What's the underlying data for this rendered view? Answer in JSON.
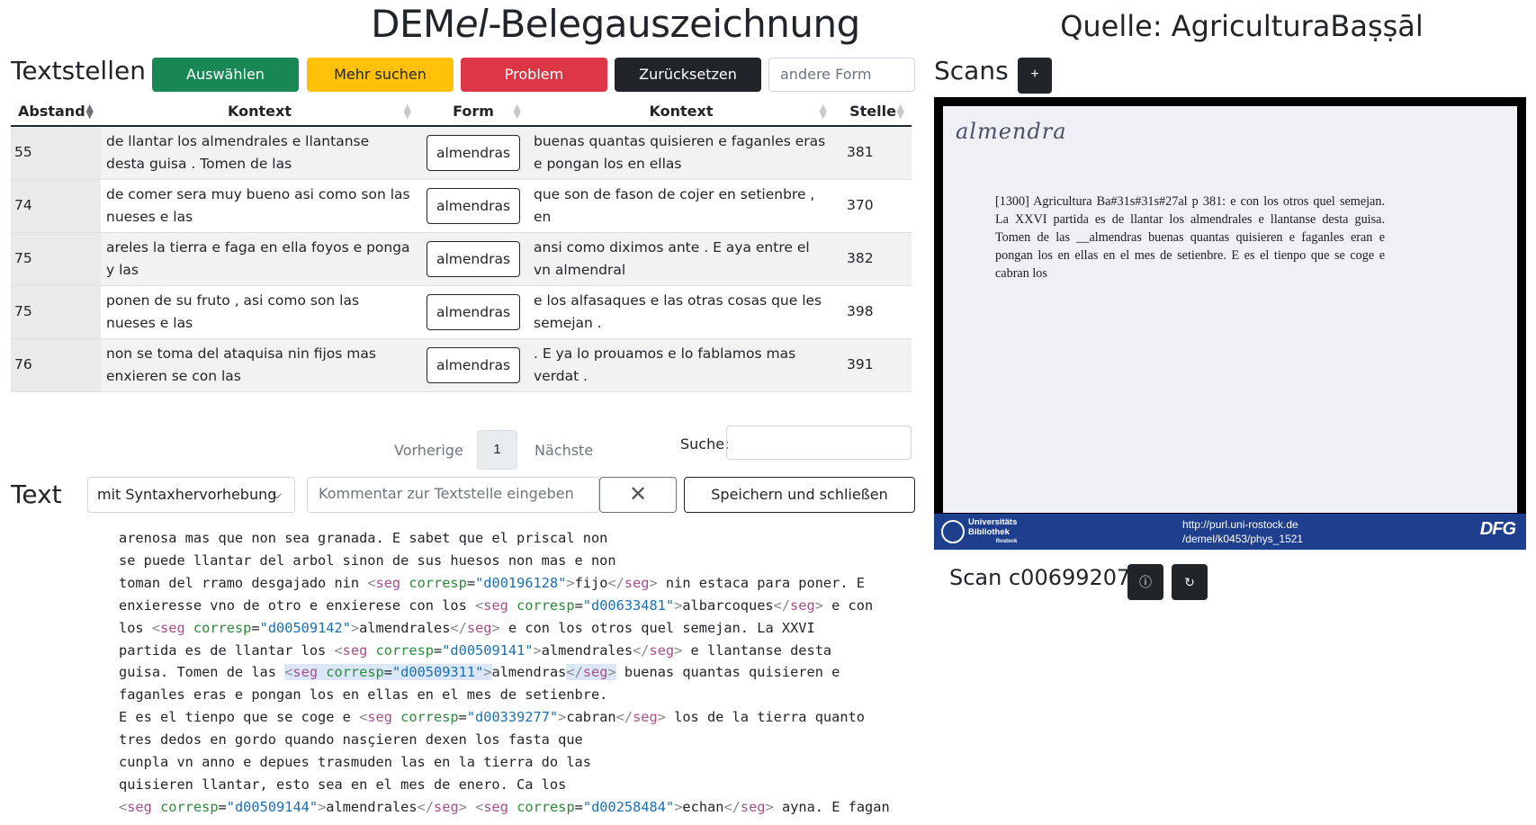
{
  "header": {
    "title_prefix": "DEM",
    "title_italic": "el",
    "title_suffix": "-Belegauszeichnung",
    "source": "Quelle: AgriculturaBaṣṣāl"
  },
  "textstellen": {
    "heading": "Textstellen",
    "buttons": {
      "select": "Auswählen",
      "more": "Mehr suchen",
      "problem": "Problem",
      "reset": "Zurücksetzen"
    },
    "other_form_placeholder": "andere Form",
    "columns": [
      "Abstand",
      "Kontext",
      "Form",
      "Kontext",
      "Stelle"
    ],
    "rows": [
      {
        "abstand": "55",
        "left": "de llantar los almendrales e llantanse desta guisa . Tomen de las",
        "form": "almendras",
        "right": "buenas quantas quisieren e faganles eras e pongan los en ellas",
        "stelle": "381"
      },
      {
        "abstand": "74",
        "left": "de comer sera muy bueno asi como son las nueses e las",
        "form": "almendras",
        "right": "que son de fason de cojer en setienbre , en",
        "stelle": "370"
      },
      {
        "abstand": "75",
        "left": "areles la tierra e faga en ella foyos e ponga y las",
        "form": "almendras",
        "right": "ansi como diximos ante . E aya entre el vn almendral",
        "stelle": "382"
      },
      {
        "abstand": "75",
        "left": "ponen de su fruto , asi como son las nueses e las",
        "form": "almendras",
        "right": "e los alfasaques e las otras cosas que les semejan .",
        "stelle": "398"
      },
      {
        "abstand": "76",
        "left": "non se toma del ataquisa nin fijos mas enxieren se con las",
        "form": "almendras",
        "right": ". E ya lo prouamos e lo fablamos mas verdat .",
        "stelle": "391"
      }
    ],
    "pagination": {
      "prev": "Vorherige",
      "page": "1",
      "next": "Nächste"
    },
    "search_label": "Suche:"
  },
  "text": {
    "heading": "Text",
    "syntax_option": "mit Syntaxhervorhebung",
    "comment_placeholder": "Kommentar zur Textstelle eingeben",
    "save_close": "Speichern und schließen",
    "lines": [
      "arenosa mas que non sea granada. E sabet que el priscal non",
      "se puede llantar del arbol sinon de sus huesos non mas e non",
      "toman del rramo desgajado nin <seg corresp=\"d00196128\">fijo</seg> nin estaca para poner. E",
      "enxieresse vno de otro e enxierese con los <seg corresp=\"d00633481\">albarcoques</seg> e con",
      "los <seg corresp=\"d00509142\">almendrales</seg> e con los otros quel semejan. La XXVI",
      "partida es de llantar los <seg corresp=\"d00509141\">almendrales</seg> e llantanse desta",
      "guisa. Tomen de las <seg corresp=\"d00509311\">almendras</seg> buenas quantas quisieren e",
      "faganles eras e pongan los en ellas en el mes de setienbre.",
      "E es el tienpo que se coge e <seg corresp=\"d00339277\">cabran</seg> los de la tierra quanto",
      "tres dedos en gordo quando nasçieren dexen los fasta que",
      "cunpla vn anno e depues trasmuden las en la tierra do las",
      "quisieren llantar, esto sea en el mes de enero. Ca los",
      "<seg corresp=\"d00509144\">almendrales</seg> <seg corresp=\"d00258484\">echan</seg> ayna. E fagan"
    ],
    "highlight_id": "d00509311"
  },
  "scans": {
    "heading": "Scans",
    "add_label": "+",
    "handwritten": "almendra",
    "scan_text": "[1300] Agricultura Ba#31s#31s#27al p 381: e con los otros quel semejan. La XXVI partida es de llantar los almendrales e llantanse desta guisa. Tomen de las __almendras buenas quantas quisieren e faganles eran e pongan los en ellas en el mes de setienbre. E es el tienpo que se coge e cabran los",
    "footer_uni_line1": "Universitäts",
    "footer_uni_line2": "Bibliothek",
    "footer_uni_line3": "Rostock",
    "footer_url_line1": "http://purl.uni-rostock.de",
    "footer_url_line2": "/demel/k0453/phys_1521",
    "footer_dfg": "DFG",
    "scan_id": "Scan c00699207",
    "info_icon": "ⓘ",
    "rotate_icon": "↻"
  },
  "colors": {
    "green": "#198754",
    "yellow": "#ffc107",
    "red": "#dc3545",
    "dark": "#212529",
    "tag": "#a5508a",
    "attr": "#2c8a3a",
    "value": "#1a6fb0",
    "highlight": "#dbe6f6"
  }
}
